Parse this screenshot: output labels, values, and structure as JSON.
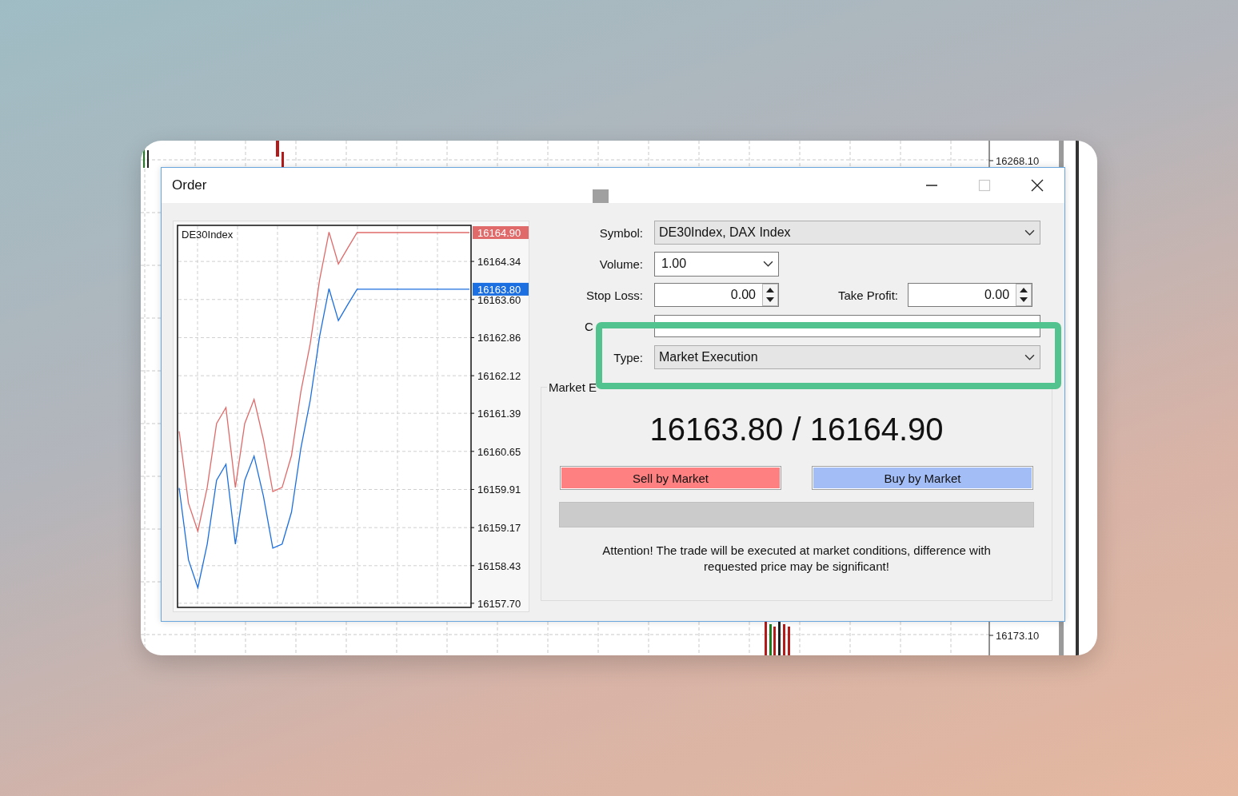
{
  "background_chart": {
    "price_labels": [
      "16268.10",
      "16173.10"
    ]
  },
  "window": {
    "title": "Order"
  },
  "chart_data": {
    "type": "line",
    "title": "DE30Index",
    "ylim": [
      16157.62,
      16165.04
    ],
    "grid": true,
    "yticks": [
      16164.34,
      {
        "value": 16163.6,
        "label": "16163.60"
      },
      16162.86,
      16162.12,
      16161.39,
      16160.65,
      16159.91,
      16159.17,
      16158.43,
      {
        "value": 16157.7,
        "label": "16157.70"
      }
    ],
    "series": [
      {
        "color": "#e06a6a",
        "values": [
          16161.04,
          16159.64,
          16159.1,
          16159.95,
          16161.19,
          16161.5,
          16159.95,
          16161.19,
          16161.66,
          16160.88,
          16159.87,
          16159.95,
          16160.57,
          16161.81,
          16162.74,
          16163.98,
          16164.91,
          16164.29,
          16164.6,
          16164.9,
          16164.9,
          16164.9,
          16164.9,
          16164.9,
          16164.9,
          16164.9,
          16164.9,
          16164.9,
          16164.9,
          16164.9,
          16164.9,
          16164.9
        ]
      },
      {
        "color": "#1c6fe0",
        "values": [
          16159.94,
          16158.54,
          16158.0,
          16158.85,
          16160.09,
          16160.4,
          16158.85,
          16160.09,
          16160.56,
          16159.78,
          16158.77,
          16158.85,
          16159.47,
          16160.71,
          16161.64,
          16162.88,
          16163.81,
          16163.19,
          16163.5,
          16163.8,
          16163.8,
          16163.8,
          16163.8,
          16163.8,
          16163.8,
          16163.8,
          16163.8,
          16163.8,
          16163.8,
          16163.8,
          16163.8,
          16163.8
        ]
      }
    ],
    "annotations": [
      "16164.90",
      "16163.80"
    ]
  },
  "form": [
    {
      "kind": "select",
      "label": "Symbol:",
      "value": "DE30Index, DAX Index"
    },
    {
      "kind": "combo",
      "label": "Volume:",
      "value": "1.00"
    },
    {
      "kind": "spin",
      "label": "Stop Loss:",
      "value": "0.00",
      "extra": {
        "label": "Take Profit:",
        "value": "0.00"
      }
    },
    {
      "kind": "text",
      "label": "C"
    },
    {
      "kind": "select",
      "label": "Type:",
      "value": "Market Execution"
    }
  ],
  "market": {
    "title": "Market E",
    "quote": "16163.80 / 16164.90",
    "buttons": [
      {
        "label": "Sell by Market",
        "color": "#ff8080"
      },
      {
        "label": "Buy by Market",
        "color": "#a3bdf7"
      }
    ],
    "notice": "Attention! The trade will be executed at market conditions, difference with requested price may be significant!"
  }
}
